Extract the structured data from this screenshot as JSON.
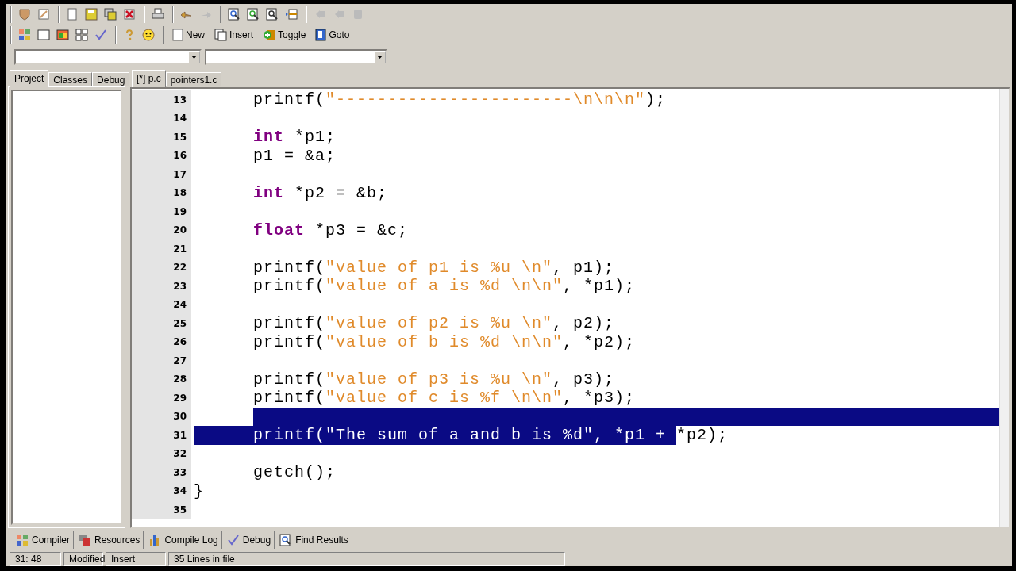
{
  "toolbar_buttons": [
    {
      "label": "New"
    },
    {
      "label": "Insert"
    },
    {
      "label": "Toggle"
    },
    {
      "label": "Goto"
    }
  ],
  "side_tabs": [
    {
      "label": "Project",
      "selected": true
    },
    {
      "label": "Classes",
      "selected": false
    },
    {
      "label": "Debug",
      "selected": false
    }
  ],
  "editor_tabs": [
    {
      "label": "[*] p.c",
      "selected": true
    },
    {
      "label": "pointers1.c",
      "selected": false
    }
  ],
  "code_lines": [
    {
      "number": "13",
      "kind": "code",
      "indented": true,
      "tokens": [
        {
          "kind": "plain",
          "text": "printf(",
          "selected": false
        },
        {
          "kind": "string",
          "text": "\"-----------------------\\n\\n\\n\"",
          "selected": false
        },
        {
          "kind": "plain",
          "text": ");",
          "selected": false
        }
      ]
    },
    {
      "number": "14",
      "kind": "blank"
    },
    {
      "number": "15",
      "kind": "code",
      "indented": true,
      "tokens": [
        {
          "kind": "keyword",
          "text": "int",
          "selected": false
        },
        {
          "kind": "plain",
          "text": " *p1;",
          "selected": false
        }
      ]
    },
    {
      "number": "16",
      "kind": "code",
      "indented": true,
      "tokens": [
        {
          "kind": "plain",
          "text": "p1 = &a;",
          "selected": false
        }
      ]
    },
    {
      "number": "17",
      "kind": "blank"
    },
    {
      "number": "18",
      "kind": "code",
      "indented": true,
      "tokens": [
        {
          "kind": "keyword",
          "text": "int",
          "selected": false
        },
        {
          "kind": "plain",
          "text": " *p2 = &b;",
          "selected": false
        }
      ]
    },
    {
      "number": "19",
      "kind": "blank"
    },
    {
      "number": "20",
      "kind": "code",
      "indented": true,
      "tokens": [
        {
          "kind": "keyword",
          "text": "float",
          "selected": false
        },
        {
          "kind": "plain",
          "text": " *p3 = &c;",
          "selected": false
        }
      ]
    },
    {
      "number": "21",
      "kind": "blank"
    },
    {
      "number": "22",
      "kind": "code",
      "indented": true,
      "tokens": [
        {
          "kind": "plain",
          "text": "printf(",
          "selected": false
        },
        {
          "kind": "string",
          "text": "\"value of p1 is %u \\n\"",
          "selected": false
        },
        {
          "kind": "plain",
          "text": ", p1);",
          "selected": false
        }
      ]
    },
    {
      "number": "23",
      "kind": "code",
      "indented": true,
      "tokens": [
        {
          "kind": "plain",
          "text": "printf(",
          "selected": false
        },
        {
          "kind": "string",
          "text": "\"value of a is %d \\n\\n\"",
          "selected": false
        },
        {
          "kind": "plain",
          "text": ", *p1);",
          "selected": false
        }
      ]
    },
    {
      "number": "24",
      "kind": "blank"
    },
    {
      "number": "25",
      "kind": "code",
      "indented": true,
      "tokens": [
        {
          "kind": "plain",
          "text": "printf(",
          "selected": false
        },
        {
          "kind": "string",
          "text": "\"value of p2 is %u \\n\"",
          "selected": false
        },
        {
          "kind": "plain",
          "text": ", p2);",
          "selected": false
        }
      ]
    },
    {
      "number": "26",
      "kind": "code",
      "indented": true,
      "tokens": [
        {
          "kind": "plain",
          "text": "printf(",
          "selected": false
        },
        {
          "kind": "string",
          "text": "\"value of b is %d \\n\\n\"",
          "selected": false
        },
        {
          "kind": "plain",
          "text": ", *p2);",
          "selected": false
        }
      ]
    },
    {
      "number": "27",
      "kind": "blank"
    },
    {
      "number": "28",
      "kind": "code",
      "indented": true,
      "tokens": [
        {
          "kind": "plain",
          "text": "printf(",
          "selected": false
        },
        {
          "kind": "string",
          "text": "\"value of p3 is %u \\n\"",
          "selected": false
        },
        {
          "kind": "plain",
          "text": ", p3);",
          "selected": false
        }
      ]
    },
    {
      "number": "29",
      "kind": "code",
      "indented": true,
      "tokens": [
        {
          "kind": "plain",
          "text": "printf(",
          "selected": false
        },
        {
          "kind": "string",
          "text": "\"value of c is %f \\n\\n\"",
          "selected": false
        },
        {
          "kind": "plain",
          "text": ", *p3);",
          "selected": false
        }
      ]
    },
    {
      "number": "30",
      "kind": "selected_blank",
      "indented": true
    },
    {
      "number": "31",
      "kind": "code",
      "indented": true,
      "tokens": [
        {
          "kind": "plain",
          "text": "printf(",
          "selected": true
        },
        {
          "kind": "string",
          "text": "\"The sum of a and b is %d\"",
          "selected": true
        },
        {
          "kind": "plain",
          "text": ", *p1 + ",
          "selected": true
        },
        {
          "kind": "plain",
          "text": "*p2);",
          "selected": false
        }
      ]
    },
    {
      "number": "32",
      "kind": "blank"
    },
    {
      "number": "33",
      "kind": "code",
      "indented": true,
      "tokens": [
        {
          "kind": "plain",
          "text": "getch();",
          "selected": false
        }
      ]
    },
    {
      "number": "34",
      "kind": "code",
      "indented": false,
      "tokens": [
        {
          "kind": "plain",
          "text": "}",
          "selected": false
        }
      ]
    },
    {
      "number": "35",
      "kind": "blank"
    }
  ],
  "bottom_tabs": [
    {
      "label": "Compiler"
    },
    {
      "label": "Resources"
    },
    {
      "label": "Compile Log"
    },
    {
      "label": "Debug"
    },
    {
      "label": "Find Results"
    }
  ],
  "status_bar": {
    "position": "31: 48",
    "modified": "Modified",
    "mode": "Insert",
    "lines": "35 Lines in file"
  }
}
